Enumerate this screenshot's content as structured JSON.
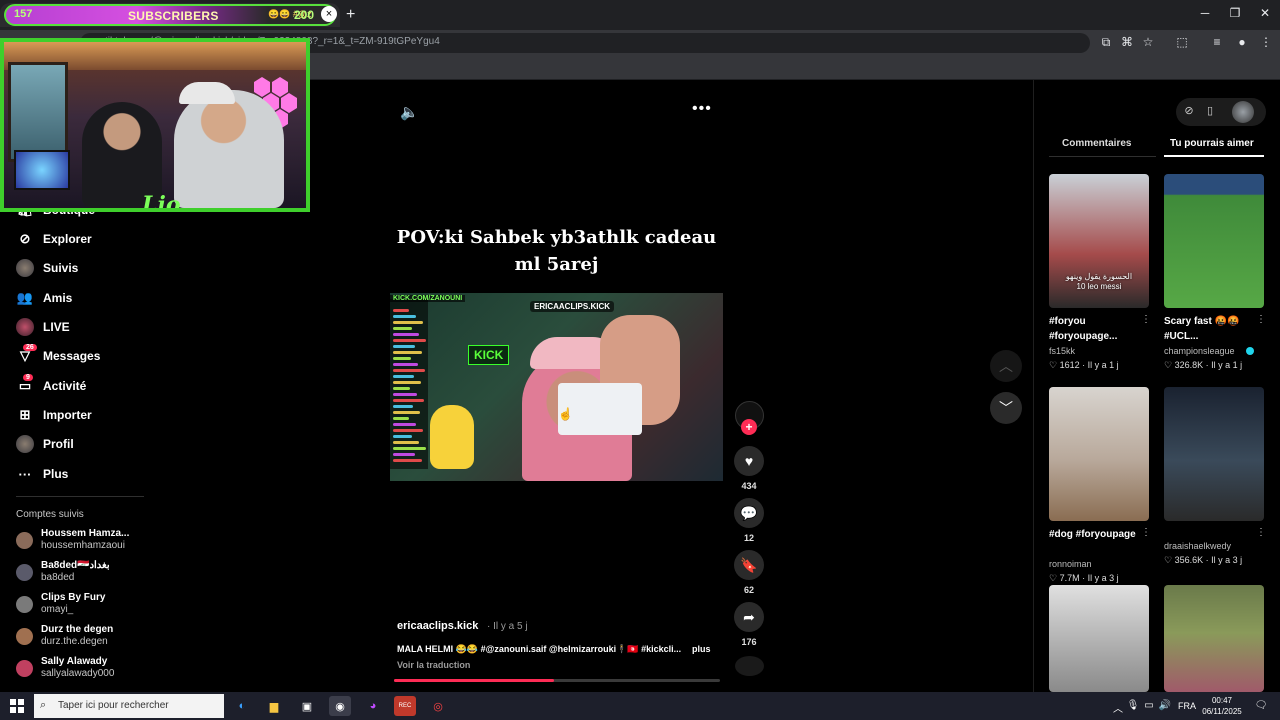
{
  "stream_overlay": {
    "sub_count": "157",
    "sub_label": "SUBSCRIBERS",
    "sub_goal": "200",
    "sub_emotes": "😀😀 #@z"
  },
  "browser": {
    "url": "tiktok.com/@ericaaclips.kick/video/7...0234808?_r=1&_t=ZM-919tGPeYgu4",
    "new_tab_label": "+",
    "close_tab_label": "×"
  },
  "sidebar": {
    "items": [
      {
        "label": "Boutique",
        "icon": "shop-icon",
        "glyph": "🛍"
      },
      {
        "label": "Explorer",
        "icon": "compass-icon",
        "glyph": "⊘"
      },
      {
        "label": "Suivis",
        "icon": "following-avatar-icon",
        "glyph": ""
      },
      {
        "label": "Amis",
        "icon": "friends-icon",
        "glyph": "👥"
      },
      {
        "label": "LIVE",
        "icon": "live-icon",
        "glyph": ""
      },
      {
        "label": "Messages",
        "icon": "messages-icon",
        "glyph": "▽",
        "badge": "26"
      },
      {
        "label": "Activité",
        "icon": "activity-icon",
        "glyph": "▭",
        "badge": "9"
      },
      {
        "label": "Importer",
        "icon": "upload-icon",
        "glyph": "⊞"
      },
      {
        "label": "Profil",
        "icon": "profile-icon",
        "glyph": ""
      },
      {
        "label": "Plus",
        "icon": "more-icon",
        "glyph": "···"
      }
    ],
    "followed_title": "Comptes suivis",
    "accounts": [
      {
        "name": "Houssem Hamza...",
        "handle": "houssemhamzaoui",
        "color": "#8a6b5a"
      },
      {
        "name": "Ba8ded🇮🇶بغداد",
        "handle": "ba8ded",
        "color": "#5a5a6a"
      },
      {
        "name": "Clips By Fury",
        "handle": "omayi_",
        "color": "#7a7a7a"
      },
      {
        "name": "Durz the degen",
        "handle": "durz.the.degen",
        "color": "#a07050"
      },
      {
        "name": "Sally Alawady",
        "handle": "sallyalawady000",
        "color": "#c04060"
      }
    ]
  },
  "video": {
    "title": "POV:ki Sahbek yb3athlk cadeau ml 5arej",
    "overlay_text_1": "KICK.COM/ZANOUNI",
    "overlay_text_2": "ERICAACLIPS.KICK",
    "sign_text": "KICK",
    "progress": 0.49,
    "creator": "ericaaclips.kick",
    "time_ago": "· Il y a 5 j",
    "caption": "MALA HELMI 😂😂 #@zanouni.saif @helmizarrouki🕴️🇹🇳 #kickcli...",
    "more_label": "plus",
    "translate_label": "Voir la traduction",
    "actions": {
      "likes": "434",
      "comments": "12",
      "saves": "62",
      "shares": "176"
    }
  },
  "right_panel": {
    "tabs": [
      "Commentaires",
      "Tu pourrais aimer"
    ],
    "active_tab": "Tu pourrais aimer",
    "cards": [
      {
        "title": "#foryou #foryoupage...",
        "author": "fs15kk",
        "likes": "1612",
        "age": "Il y a 1 j",
        "overlay": "الحسورة يقول وينهو\n10 leo messi",
        "bg": "linear-gradient(180deg,#c9d0d6,#a54b4b 60%,#2a2a2a)"
      },
      {
        "title": "Scary fast 🤬🤬 #UCL...",
        "author": "championsleague",
        "verified": true,
        "likes": "326.8K",
        "age": "Il y a 1 j",
        "bg": "linear-gradient(180deg,#2b4d7a 0 15%,#3f8a3a 16%,#57a846)"
      },
      {
        "title": "#dog #foryoupage",
        "author": "ronnoiman",
        "likes": "7.7M",
        "age": "Il y a 3 j",
        "bg": "linear-gradient(180deg,#d8d4cf,#b8a89a 55%,#8a6d52)"
      },
      {
        "title": "",
        "author": "draaishaelkwedy",
        "likes": "356.6K",
        "age": "Il y a 3 j",
        "bg": "linear-gradient(180deg,#1a2230,#3a4a5a 55%,#2a2a2a)"
      },
      {
        "title": "",
        "author": "",
        "likes": "",
        "age": "",
        "bg": "linear-gradient(180deg,#e0e0e0,#bdbdbd 40%,#8a8a8a)"
      },
      {
        "title": "",
        "author": "",
        "likes": "",
        "age": "",
        "bg": "linear-gradient(180deg,#6a7a4a,#8a9a5a 45%,#a05a6a)"
      }
    ]
  },
  "taskbar": {
    "search_placeholder": "Taper ici pour rechercher",
    "language": "FRA",
    "time": "00:47",
    "date": "06/11/2025"
  }
}
